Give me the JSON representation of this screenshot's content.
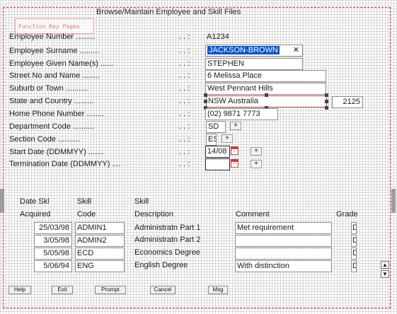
{
  "window": {
    "title": "Browse/Maintain Employee and Skill Files"
  },
  "ghost_panel": {
    "text": "Function Key Pages"
  },
  "fields": [
    {
      "label": "Employee Number .........",
      "value": "A1234"
    },
    {
      "label": "Employee Surname .........",
      "value": "JACKSON-BROWN"
    },
    {
      "label": "Employee Given Name(s) ......",
      "value": "STEPHEN"
    },
    {
      "label": "Street No and Name ........",
      "value": "6 Melissa Place"
    },
    {
      "label": "Suburb or Town ..........",
      "value": "West Pennant Hills"
    },
    {
      "label": "State and Country .........",
      "value": "NSW Australia",
      "postcode": "2125"
    },
    {
      "label": "Home Phone Number ........",
      "value": "(02) 9871 7773"
    },
    {
      "label": "Department Code ..........",
      "value": "SD",
      "plus": "+"
    },
    {
      "label": "Section Code ..........",
      "value": "ES",
      "plus": "+"
    },
    {
      "label": "Start Date (DDMMYY) .......",
      "value": "14/08",
      "plus": "+"
    },
    {
      "label": "Termination Date (DDMMYY) ....",
      "value": "",
      "plus": "+"
    }
  ],
  "separator": "..:",
  "clear_glyph": "✕",
  "skills": {
    "headers": {
      "date_line1": "Date Skl",
      "date_line2": "Acquired",
      "skill_line1": "Skill",
      "skill_line2": "Code",
      "desc_line1": "Skill",
      "desc_line2": "Description",
      "comment": "Comment",
      "grade": "Grade"
    },
    "rows": [
      {
        "date": "25/03/98",
        "code": "ADMIN1",
        "description": "Administratn Part 1",
        "comment": "Met requirement",
        "grade": "D"
      },
      {
        "date": "3/05/98",
        "code": "ADMIN2",
        "description": "Administratn Part 2",
        "comment": "",
        "grade": "D"
      },
      {
        "date": "5/05/98",
        "code": "ECD",
        "description": "Economics Degree",
        "comment": "",
        "grade": "D"
      },
      {
        "date": "5/06/94",
        "code": "ENG",
        "description": "English Degree",
        "comment": "With distinction",
        "grade": "D"
      }
    ]
  },
  "scroll": {
    "up": "▲",
    "down": "▼"
  },
  "buttons": {
    "help": "Help",
    "exit": "Exit",
    "prompt": "Prompt",
    "cancel": "Cancel",
    "msg": "Msg"
  }
}
